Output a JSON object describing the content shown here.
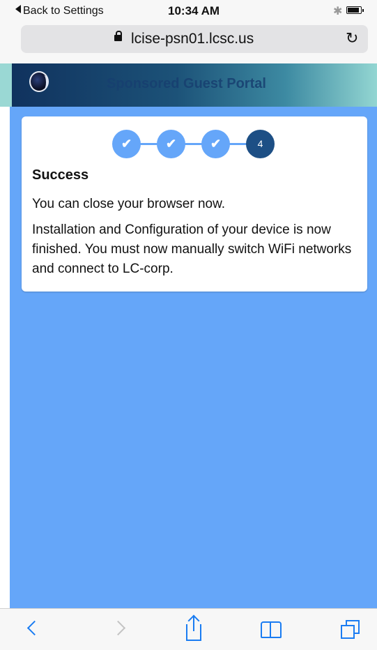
{
  "status_bar": {
    "back_label": "Back to Settings",
    "time": "10:34 AM",
    "bluetooth_icon": "bluetooth-icon",
    "battery_icon": "battery-icon",
    "battery_level": 0.9
  },
  "browser": {
    "url": "lcise-psn01.lcsc.us",
    "lock_icon": "lock-icon",
    "reload_icon": "reload-icon"
  },
  "portal": {
    "title": "Sponsored Guest Portal",
    "logo_icon": "portal-logo-icon"
  },
  "progress": {
    "steps": [
      {
        "status": "complete",
        "glyph": "✔"
      },
      {
        "status": "complete",
        "glyph": "✔"
      },
      {
        "status": "complete",
        "glyph": "✔"
      },
      {
        "status": "current",
        "label": "4"
      }
    ]
  },
  "card": {
    "heading": "Success",
    "message_1": "You can close your browser now.",
    "message_2": "Installation and Configuration of your device is now finished. You must now manually switch WiFi networks and connect to LC-corp."
  },
  "toolbar": {
    "icons": [
      "back-icon",
      "forward-icon",
      "share-icon",
      "bookmarks-icon",
      "tabs-icon"
    ]
  },
  "colors": {
    "page_background": "#65a6f9",
    "step_complete": "#65a6f9",
    "step_current": "#1d4f85",
    "ios_blue": "#1a7cf2"
  }
}
